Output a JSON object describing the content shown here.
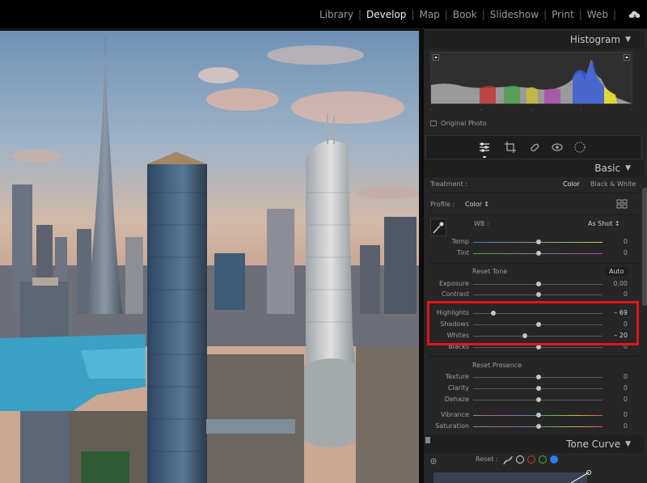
{
  "topbar": {
    "modules": [
      "Library",
      "Develop",
      "Map",
      "Book",
      "Slideshow",
      "Print",
      "Web"
    ],
    "active": "Develop"
  },
  "histogram": {
    "title": "Histogram",
    "original_photo_label": "Original Photo"
  },
  "basic": {
    "title": "Basic",
    "treatment_label": "Treatment :",
    "treatment_color": "Color",
    "treatment_bw": "Black & White",
    "profile_label": "Profile :",
    "profile_value": "Color ↕",
    "wb_label": "WB :",
    "wb_value": "As Shot ↕",
    "temp": {
      "label": "Temp",
      "value": "0"
    },
    "tint": {
      "label": "Tint",
      "value": "0"
    },
    "reset_tone": "Reset Tone",
    "auto": "Auto",
    "exposure": {
      "label": "Exposure",
      "value": "0,00"
    },
    "contrast": {
      "label": "Contrast",
      "value": "0"
    },
    "highlights": {
      "label": "Highlights",
      "value": "– 69",
      "level": -69
    },
    "shadows": {
      "label": "Shadows",
      "value": "0"
    },
    "whites": {
      "label": "Whites",
      "value": "– 20",
      "level": -20
    },
    "blacks": {
      "label": "Blacks",
      "value": "0"
    },
    "reset_presence": "Reset Presence",
    "texture": {
      "label": "Texture",
      "value": "0"
    },
    "clarity": {
      "label": "Clarity",
      "value": "0"
    },
    "dehaze": {
      "label": "Dehaze",
      "value": "0"
    },
    "vibrance": {
      "label": "Vibrance",
      "value": "0"
    },
    "saturation": {
      "label": "Saturation",
      "value": "0"
    }
  },
  "tone_curve": {
    "title": "Tone Curve",
    "reset_label": "Reset :"
  },
  "colors": {
    "highlight_box": "#e3141b",
    "active_module": "#f2f2f2"
  }
}
